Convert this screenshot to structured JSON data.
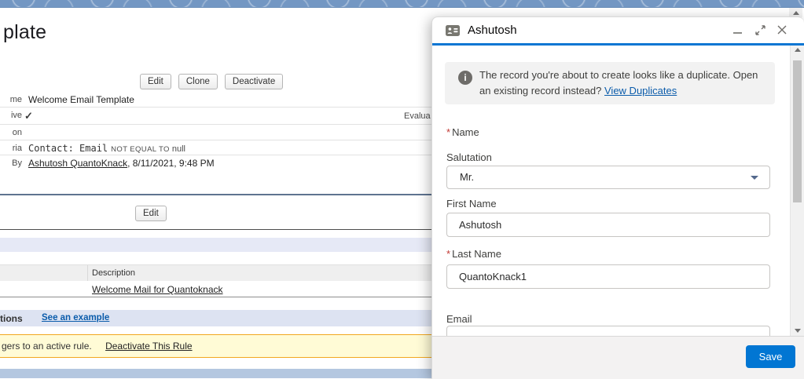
{
  "colors": {
    "header_band_blue": "#7397c3",
    "modal_accent_blue": "#0b76d3",
    "save_button_blue": "#0176d3",
    "link_blue": "#0b5cab",
    "required_red": "#c23934",
    "notice_bg": "#fffbd6",
    "notice_border": "#f2a71e",
    "lavender_band": "#dde3f2",
    "bottom_band_blue": "#b4c7e0"
  },
  "icons": {
    "record": "contact-card-icon",
    "minimize": "minimize-icon",
    "expand": "expand-icon",
    "close": "close-icon",
    "info": "info-icon",
    "chevron": "chevron-down-icon",
    "check_glyph": "✓",
    "scroll_up_glyph": "▲",
    "scroll_down_glyph": "▼"
  },
  "page": {
    "title_truncated": "plate",
    "buttons": {
      "edit": "Edit",
      "clone": "Clone",
      "deactivate": "Deactivate"
    },
    "detail": {
      "rows": [
        {
          "label": "me",
          "value": "Welcome Email Template"
        },
        {
          "label": "ive",
          "value": "✓"
        },
        {
          "label": "on",
          "value": ""
        },
        {
          "label": "ria",
          "criteria_field": "Contact: Email",
          "criteria_op": "NOT EQUAL TO",
          "criteria_value": "null"
        },
        {
          "label": "By",
          "link": "Ashutosh QuantoKnack",
          "suffix": ", 8/11/2021, 9:48 PM"
        }
      ],
      "right_column_label_truncated": "Evalua"
    },
    "edit_section_button": "Edit",
    "actions_table": {
      "description_header": "Description",
      "row_description_link": "Welcome Mail for Quantoknack"
    },
    "workflow_actions": {
      "title_truncated": "tions",
      "example_link": "See an example"
    },
    "notice": {
      "text_truncated": "gers to an active rule.",
      "link": "Deactivate This Rule"
    }
  },
  "modal": {
    "title": "Ashutosh",
    "duplicate_alert": {
      "line1": "The record you're about to create looks like a duplicate. Open",
      "line2": "an existing record instead?",
      "link": "View Duplicates"
    },
    "required_marker": "*",
    "fields": {
      "name_label": "Name",
      "salutation_label": "Salutation",
      "salutation_value": "Mr.",
      "first_name_label": "First Name",
      "first_name_value": "Ashutosh",
      "last_name_label": "Last Name",
      "last_name_value": "QuantoKnack1",
      "email_label": "Email",
      "email_value": ""
    },
    "save_label": "Save"
  }
}
